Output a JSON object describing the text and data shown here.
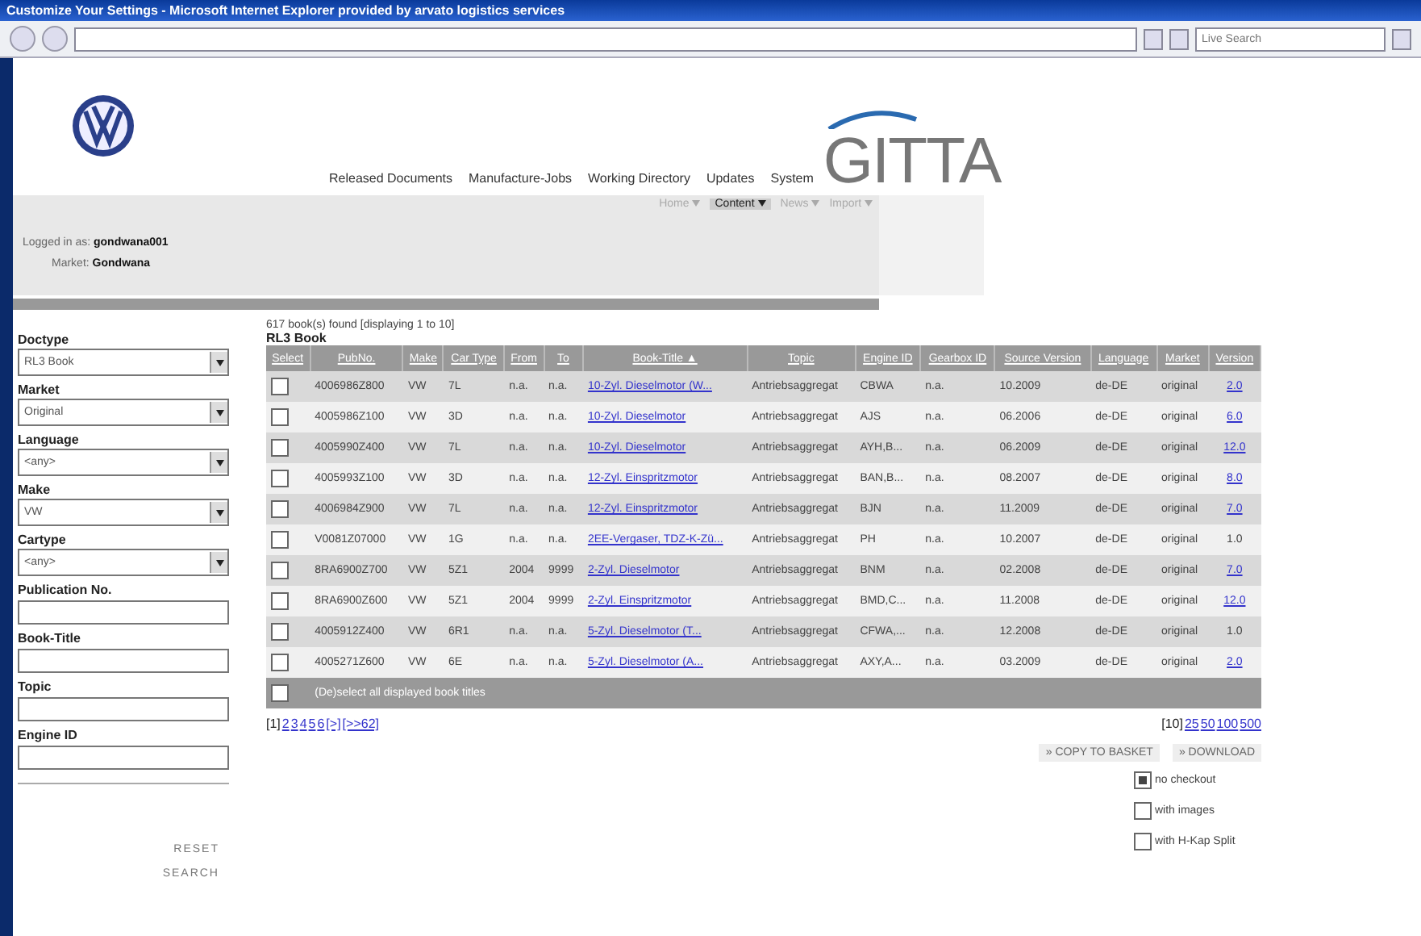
{
  "window": {
    "title": "Customize Your Settings - Microsoft Internet Explorer provided by arvato logistics services"
  },
  "toolbar": {
    "search_placeholder": "Live Search"
  },
  "header": {
    "logo_text": "GITTA",
    "nav": [
      "Released Documents",
      "Manufacture-Jobs",
      "Working Directory",
      "Updates",
      "System"
    ],
    "subnav": [
      {
        "label": "Home",
        "selected": false
      },
      {
        "label": "Content",
        "selected": true
      },
      {
        "label": "News",
        "selected": false
      },
      {
        "label": "Import",
        "selected": false
      }
    ],
    "logged_in_label": "Logged in as:",
    "user": "gondwana001",
    "market_label": "Market:",
    "market": "Gondwana"
  },
  "sidebar": {
    "fields": [
      {
        "kind": "select",
        "label": "Doctype",
        "value": "RL3 Book"
      },
      {
        "kind": "select",
        "label": "Market",
        "value": "Original"
      },
      {
        "kind": "select",
        "label": "Language",
        "value": "<any>"
      },
      {
        "kind": "select",
        "label": "Make",
        "value": "VW"
      },
      {
        "kind": "select",
        "label": "Cartype",
        "value": "<any>"
      },
      {
        "kind": "text",
        "label": "Publication No."
      },
      {
        "kind": "text",
        "label": "Book-Title"
      },
      {
        "kind": "text",
        "label": "Topic"
      },
      {
        "kind": "text",
        "label": "Engine ID"
      }
    ],
    "buttons": [
      "RESET",
      "SEARCH"
    ]
  },
  "results": {
    "summary": "617 book(s) found [displaying 1 to 10]",
    "heading": "RL3 Book",
    "columns": [
      "Select",
      "PubNo.",
      "Make",
      "Car Type",
      "From",
      "To",
      "Book-Title ▲",
      "Topic",
      "Engine ID",
      "Gearbox ID",
      "Source Version",
      "Language",
      "Market",
      "Version"
    ],
    "rows": [
      {
        "checked": false,
        "cells": [
          "",
          "4006986Z800",
          "VW",
          "7L",
          "n.a.",
          "n.a.",
          "10-Zyl. Dieselmotor (W...",
          "Antriebsaggregat",
          "CBWA",
          "n.a.",
          "10.2009",
          "de-DE",
          "original",
          "2.0"
        ],
        "version_link": true
      },
      {
        "checked": false,
        "cells": [
          "",
          "4005986Z100",
          "VW",
          "3D",
          "n.a.",
          "n.a.",
          "10-Zyl. Dieselmotor",
          "Antriebsaggregat",
          "AJS",
          "n.a.",
          "06.2006",
          "de-DE",
          "original",
          "6.0"
        ],
        "version_link": true
      },
      {
        "checked": false,
        "cells": [
          "",
          "4005990Z400",
          "VW",
          "7L",
          "n.a.",
          "n.a.",
          "10-Zyl. Dieselmotor",
          "Antriebsaggregat",
          "AYH,B...",
          "n.a.",
          "06.2009",
          "de-DE",
          "original",
          "12.0"
        ],
        "version_link": true
      },
      {
        "checked": false,
        "cells": [
          "",
          "4005993Z100",
          "VW",
          "3D",
          "n.a.",
          "n.a.",
          "12-Zyl. Einspritzmotor",
          "Antriebsaggregat",
          "BAN,B...",
          "n.a.",
          "08.2007",
          "de-DE",
          "original",
          "8.0"
        ],
        "version_link": true
      },
      {
        "checked": false,
        "cells": [
          "",
          "4006984Z900",
          "VW",
          "7L",
          "n.a.",
          "n.a.",
          "12-Zyl. Einspritzmotor",
          "Antriebsaggregat",
          "BJN",
          "n.a.",
          "11.2009",
          "de-DE",
          "original",
          "7.0"
        ],
        "version_link": true
      },
      {
        "checked": false,
        "cells": [
          "",
          "V0081Z07000",
          "VW",
          "1G",
          "n.a.",
          "n.a.",
          "2EE-Vergaser, TDZ-K-Zü...",
          "Antriebsaggregat",
          "PH",
          "n.a.",
          "10.2007",
          "de-DE",
          "original",
          "1.0"
        ],
        "version_link": false
      },
      {
        "checked": false,
        "cells": [
          "",
          "8RA6900Z700",
          "VW",
          "5Z1",
          "2004",
          "9999",
          "2-Zyl. Dieselmotor",
          "Antriebsaggregat",
          "BNM",
          "n.a.",
          "02.2008",
          "de-DE",
          "original",
          "7.0"
        ],
        "version_link": true
      },
      {
        "checked": false,
        "cells": [
          "",
          "8RA6900Z600",
          "VW",
          "5Z1",
          "2004",
          "9999",
          "2-Zyl. Einspritzmotor",
          "Antriebsaggregat",
          "BMD,C...",
          "n.a.",
          "11.2008",
          "de-DE",
          "original",
          "12.0"
        ],
        "version_link": true
      },
      {
        "checked": false,
        "cells": [
          "",
          "4005912Z400",
          "VW",
          "6R1",
          "n.a.",
          "n.a.",
          "5-Zyl. Dieselmotor (T...",
          "Antriebsaggregat",
          "CFWA,...",
          "n.a.",
          "12.2008",
          "de-DE",
          "original",
          "1.0"
        ],
        "version_link": false
      },
      {
        "checked": false,
        "cells": [
          "",
          "4005271Z600",
          "VW",
          "6E",
          "n.a.",
          "n.a.",
          "5-Zyl. Dieselmotor (A...",
          "Antriebsaggregat",
          "AXY,A...",
          "n.a.",
          "03.2009",
          "de-DE",
          "original",
          "2.0"
        ],
        "version_link": true
      }
    ],
    "select_all": {
      "label": "(De)select all displayed book titles",
      "checked": false
    },
    "pages": [
      {
        "label": "[1]",
        "selected": true
      },
      {
        "label": "2",
        "selected": false
      },
      {
        "label": "3",
        "selected": false
      },
      {
        "label": "4",
        "selected": false
      },
      {
        "label": "5",
        "selected": false
      },
      {
        "label": "6",
        "selected": false
      },
      {
        "label": "[>]",
        "selected": false
      },
      {
        "label": "[>>62]",
        "selected": false
      }
    ],
    "page_sizes": [
      {
        "label": "[10]",
        "selected": true
      },
      {
        "label": "25",
        "selected": false
      },
      {
        "label": "50",
        "selected": false
      },
      {
        "label": "100",
        "selected": false
      },
      {
        "label": "500",
        "selected": false
      }
    ],
    "actions": [
      "» COPY TO BASKET",
      "» DOWNLOAD"
    ],
    "options": [
      {
        "label": "no checkout",
        "checked": true
      },
      {
        "label": "with images",
        "checked": false
      },
      {
        "label": "with H-Kap Split",
        "checked": false
      }
    ]
  }
}
